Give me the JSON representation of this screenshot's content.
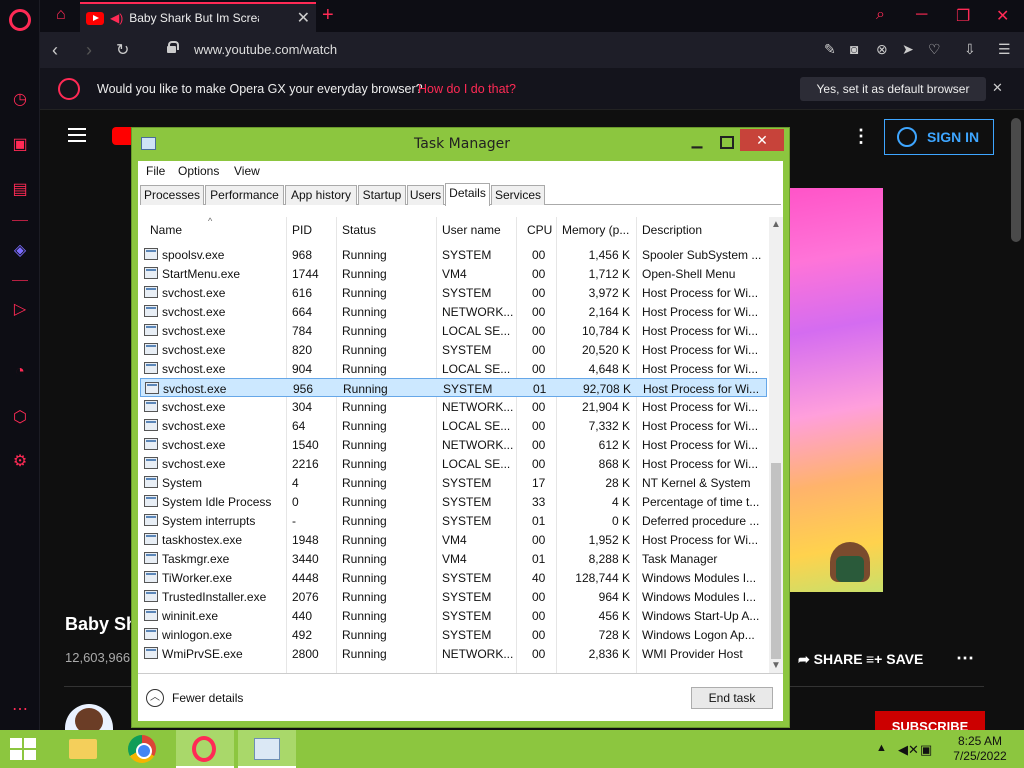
{
  "browser": {
    "tab_title": "Baby Shark But Im Screaming",
    "url": "www.youtube.com/watch",
    "prompt_text": "Would you like to make Opera GX your everyday browser?",
    "prompt_link": "How do I do that?",
    "prompt_button": "Yes, set it as default browser"
  },
  "youtube": {
    "signin_label": "SIGN IN",
    "video_title": "Baby Sh",
    "views": "12,603,966",
    "share_label": "SHARE",
    "save_label": "SAVE",
    "subscribe_label": "SUBSCRIBE"
  },
  "task_manager": {
    "title": "Task Manager",
    "menu": [
      "File",
      "Options",
      "View"
    ],
    "tabs": [
      "Processes",
      "Performance",
      "App history",
      "Startup",
      "Users",
      "Details",
      "Services"
    ],
    "active_tab": "Details",
    "columns": [
      "Name",
      "PID",
      "Status",
      "User name",
      "CPU",
      "Memory (p...",
      "Description"
    ],
    "rows": [
      [
        "spoolsv.exe",
        "968",
        "Running",
        "SYSTEM",
        "00",
        "1,456 K",
        "Spooler SubSystem ..."
      ],
      [
        "StartMenu.exe",
        "1744",
        "Running",
        "VM4",
        "00",
        "1,712 K",
        "Open-Shell Menu"
      ],
      [
        "svchost.exe",
        "616",
        "Running",
        "SYSTEM",
        "00",
        "3,972 K",
        "Host Process for Wi..."
      ],
      [
        "svchost.exe",
        "664",
        "Running",
        "NETWORK...",
        "00",
        "2,164 K",
        "Host Process for Wi..."
      ],
      [
        "svchost.exe",
        "784",
        "Running",
        "LOCAL SE...",
        "00",
        "10,784 K",
        "Host Process for Wi..."
      ],
      [
        "svchost.exe",
        "820",
        "Running",
        "SYSTEM",
        "00",
        "20,520 K",
        "Host Process for Wi..."
      ],
      [
        "svchost.exe",
        "904",
        "Running",
        "LOCAL SE...",
        "00",
        "4,648 K",
        "Host Process for Wi..."
      ],
      [
        "svchost.exe",
        "956",
        "Running",
        "SYSTEM",
        "01",
        "92,708 K",
        "Host Process for Wi..."
      ],
      [
        "svchost.exe",
        "304",
        "Running",
        "NETWORK...",
        "00",
        "21,904 K",
        "Host Process for Wi..."
      ],
      [
        "svchost.exe",
        "64",
        "Running",
        "LOCAL SE...",
        "00",
        "7,332 K",
        "Host Process for Wi..."
      ],
      [
        "svchost.exe",
        "1540",
        "Running",
        "NETWORK...",
        "00",
        "612 K",
        "Host Process for Wi..."
      ],
      [
        "svchost.exe",
        "2216",
        "Running",
        "LOCAL SE...",
        "00",
        "868 K",
        "Host Process for Wi..."
      ],
      [
        "System",
        "4",
        "Running",
        "SYSTEM",
        "17",
        "28 K",
        "NT Kernel & System"
      ],
      [
        "System Idle Process",
        "0",
        "Running",
        "SYSTEM",
        "33",
        "4 K",
        "Percentage of time t..."
      ],
      [
        "System interrupts",
        "-",
        "Running",
        "SYSTEM",
        "01",
        "0 K",
        "Deferred procedure ..."
      ],
      [
        "taskhostex.exe",
        "1948",
        "Running",
        "VM4",
        "00",
        "1,952 K",
        "Host Process for Wi..."
      ],
      [
        "Taskmgr.exe",
        "3440",
        "Running",
        "VM4",
        "01",
        "8,288 K",
        "Task Manager"
      ],
      [
        "TiWorker.exe",
        "4448",
        "Running",
        "SYSTEM",
        "40",
        "128,744 K",
        "Windows Modules I..."
      ],
      [
        "TrustedInstaller.exe",
        "2076",
        "Running",
        "SYSTEM",
        "00",
        "964 K",
        "Windows Modules I..."
      ],
      [
        "wininit.exe",
        "440",
        "Running",
        "SYSTEM",
        "00",
        "456 K",
        "Windows Start-Up A..."
      ],
      [
        "winlogon.exe",
        "492",
        "Running",
        "SYSTEM",
        "00",
        "728 K",
        "Windows Logon Ap..."
      ],
      [
        "WmiPrvSE.exe",
        "2800",
        "Running",
        "NETWORK...",
        "00",
        "2,836 K",
        "WMI Provider Host"
      ]
    ],
    "selected_row": 7,
    "fewer_details": "Fewer details",
    "end_task": "End task"
  },
  "taskbar": {
    "time": "8:25 AM",
    "date": "7/25/2022"
  },
  "colors": {
    "accent": "#ff2a55",
    "window_green": "#8cc63f",
    "selection": "#cce8ff"
  }
}
